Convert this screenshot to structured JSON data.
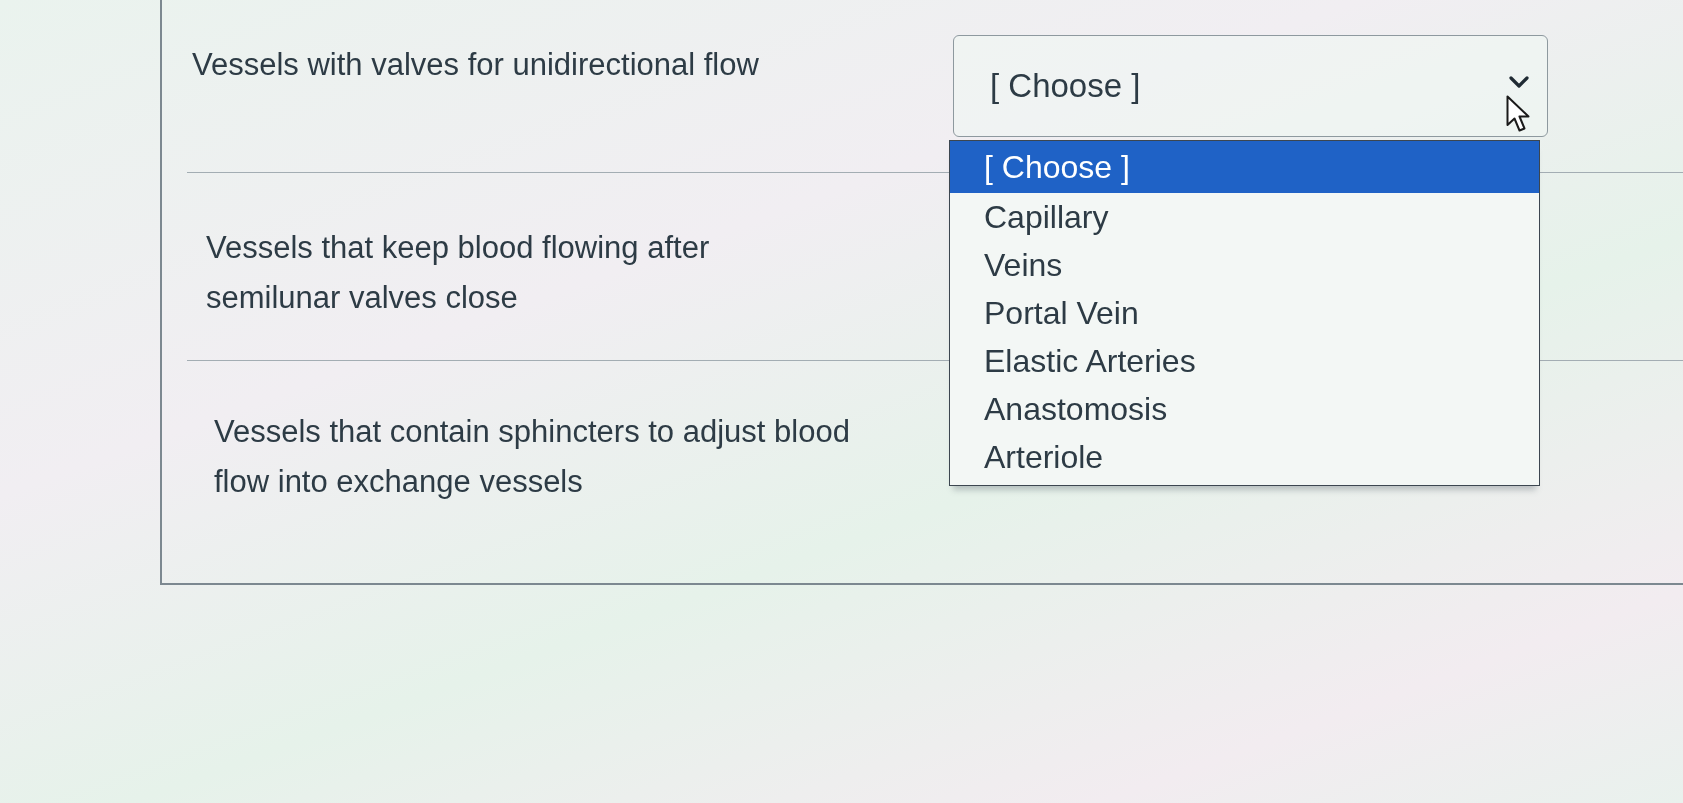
{
  "questions": [
    {
      "prompt": "Vessels with valves for unidirectional flow",
      "select": {
        "value": "[ Choose ]",
        "expanded": true,
        "options": [
          {
            "label": "[ Choose ]",
            "selected": true
          },
          {
            "label": "Capillary",
            "selected": false
          },
          {
            "label": "Veins",
            "selected": false
          },
          {
            "label": "Portal Vein",
            "selected": false
          },
          {
            "label": "Elastic Arteries",
            "selected": false
          },
          {
            "label": "Anastomosis",
            "selected": false
          },
          {
            "label": "Arteriole",
            "selected": false
          }
        ]
      }
    },
    {
      "prompt": "Vessels that keep blood flowing after semilunar valves close"
    },
    {
      "prompt": "Vessels that contain sphincters to adjust blood flow into exchange vessels"
    }
  ]
}
